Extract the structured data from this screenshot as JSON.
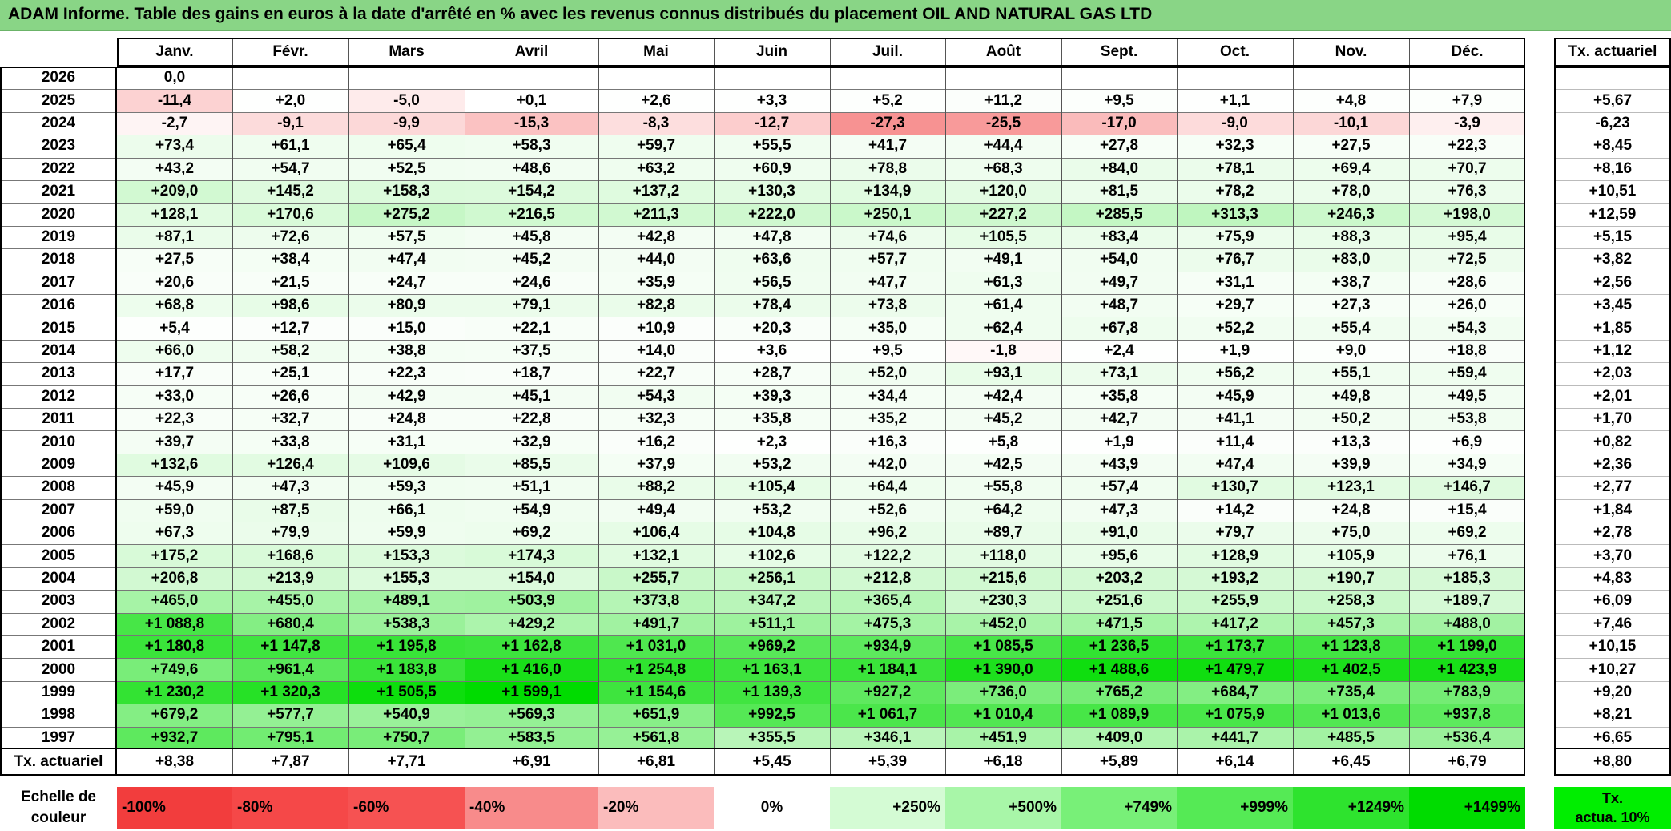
{
  "title": "ADAM Informe. Table des gains en euros à la date d'arrêté en % avec les revenus connus distribués du placement OIL AND NATURAL GAS LTD",
  "months": [
    "Janv.",
    "Févr.",
    "Mars",
    "Avril",
    "Mai",
    "Juin",
    "Juil.",
    "Août",
    "Sept.",
    "Oct.",
    "Nov.",
    "Déc."
  ],
  "rate_header": "Tx. actuariel",
  "rows": [
    {
      "year": "2026",
      "values": [
        "0,0",
        "",
        "",
        "",
        "",
        "",
        "",
        "",
        "",
        "",
        "",
        ""
      ],
      "rate": ""
    },
    {
      "year": "2025",
      "values": [
        "-11,4",
        "+2,0",
        "-5,0",
        "+0,1",
        "+2,6",
        "+3,3",
        "+5,2",
        "+11,2",
        "+9,5",
        "+1,1",
        "+4,8",
        "+7,9"
      ],
      "rate": "+5,67"
    },
    {
      "year": "2024",
      "values": [
        "-2,7",
        "-9,1",
        "-9,9",
        "-15,3",
        "-8,3",
        "-12,7",
        "-27,3",
        "-25,5",
        "-17,0",
        "-9,0",
        "-10,1",
        "-3,9"
      ],
      "rate": "-6,23"
    },
    {
      "year": "2023",
      "values": [
        "+73,4",
        "+61,1",
        "+65,4",
        "+58,3",
        "+59,7",
        "+55,5",
        "+41,7",
        "+44,4",
        "+27,8",
        "+32,3",
        "+27,5",
        "+22,3"
      ],
      "rate": "+8,45"
    },
    {
      "year": "2022",
      "values": [
        "+43,2",
        "+54,7",
        "+52,5",
        "+48,6",
        "+63,2",
        "+60,9",
        "+78,8",
        "+68,3",
        "+84,0",
        "+78,1",
        "+69,4",
        "+70,7"
      ],
      "rate": "+8,16"
    },
    {
      "year": "2021",
      "values": [
        "+209,0",
        "+145,2",
        "+158,3",
        "+154,2",
        "+137,2",
        "+130,3",
        "+134,9",
        "+120,0",
        "+81,5",
        "+78,2",
        "+78,0",
        "+76,3"
      ],
      "rate": "+10,51"
    },
    {
      "year": "2020",
      "values": [
        "+128,1",
        "+170,6",
        "+275,2",
        "+216,5",
        "+211,3",
        "+222,0",
        "+250,1",
        "+227,2",
        "+285,5",
        "+313,3",
        "+246,3",
        "+198,0"
      ],
      "rate": "+12,59"
    },
    {
      "year": "2019",
      "values": [
        "+87,1",
        "+72,6",
        "+57,5",
        "+45,8",
        "+42,8",
        "+47,8",
        "+74,6",
        "+105,5",
        "+83,4",
        "+75,9",
        "+88,3",
        "+95,4"
      ],
      "rate": "+5,15"
    },
    {
      "year": "2018",
      "values": [
        "+27,5",
        "+38,4",
        "+47,4",
        "+45,2",
        "+44,0",
        "+63,6",
        "+57,7",
        "+49,1",
        "+54,0",
        "+76,7",
        "+83,0",
        "+72,5"
      ],
      "rate": "+3,82"
    },
    {
      "year": "2017",
      "values": [
        "+20,6",
        "+21,5",
        "+24,7",
        "+24,6",
        "+35,9",
        "+56,5",
        "+47,7",
        "+61,3",
        "+49,7",
        "+31,1",
        "+38,7",
        "+28,6"
      ],
      "rate": "+2,56"
    },
    {
      "year": "2016",
      "values": [
        "+68,8",
        "+98,6",
        "+80,9",
        "+79,1",
        "+82,8",
        "+78,4",
        "+73,8",
        "+61,4",
        "+48,7",
        "+29,7",
        "+27,3",
        "+26,0"
      ],
      "rate": "+3,45"
    },
    {
      "year": "2015",
      "values": [
        "+5,4",
        "+12,7",
        "+15,0",
        "+22,1",
        "+10,9",
        "+20,3",
        "+35,0",
        "+62,4",
        "+67,8",
        "+52,2",
        "+55,4",
        "+54,3"
      ],
      "rate": "+1,85"
    },
    {
      "year": "2014",
      "values": [
        "+66,0",
        "+58,2",
        "+38,8",
        "+37,5",
        "+14,0",
        "+3,6",
        "+9,5",
        "-1,8",
        "+2,4",
        "+1,9",
        "+9,0",
        "+18,8"
      ],
      "rate": "+1,12"
    },
    {
      "year": "2013",
      "values": [
        "+17,7",
        "+25,1",
        "+22,3",
        "+18,7",
        "+22,7",
        "+28,7",
        "+52,0",
        "+93,1",
        "+73,1",
        "+56,2",
        "+55,1",
        "+59,4"
      ],
      "rate": "+2,03"
    },
    {
      "year": "2012",
      "values": [
        "+33,0",
        "+26,6",
        "+42,9",
        "+45,1",
        "+54,3",
        "+39,3",
        "+34,4",
        "+42,4",
        "+35,8",
        "+45,9",
        "+49,8",
        "+49,5"
      ],
      "rate": "+2,01"
    },
    {
      "year": "2011",
      "values": [
        "+22,3",
        "+32,7",
        "+24,8",
        "+22,8",
        "+32,3",
        "+35,8",
        "+35,2",
        "+45,2",
        "+42,7",
        "+41,1",
        "+50,2",
        "+53,8"
      ],
      "rate": "+1,70"
    },
    {
      "year": "2010",
      "values": [
        "+39,7",
        "+33,8",
        "+31,1",
        "+32,9",
        "+16,2",
        "+2,3",
        "+16,3",
        "+5,8",
        "+1,9",
        "+11,4",
        "+13,3",
        "+6,9"
      ],
      "rate": "+0,82"
    },
    {
      "year": "2009",
      "values": [
        "+132,6",
        "+126,4",
        "+109,6",
        "+85,5",
        "+37,9",
        "+53,2",
        "+42,0",
        "+42,5",
        "+43,9",
        "+47,4",
        "+39,9",
        "+34,9"
      ],
      "rate": "+2,36"
    },
    {
      "year": "2008",
      "values": [
        "+45,9",
        "+47,3",
        "+59,3",
        "+51,1",
        "+88,2",
        "+105,4",
        "+64,4",
        "+55,8",
        "+57,4",
        "+130,7",
        "+123,1",
        "+146,7"
      ],
      "rate": "+2,77"
    },
    {
      "year": "2007",
      "values": [
        "+59,0",
        "+87,5",
        "+66,1",
        "+54,9",
        "+49,4",
        "+53,2",
        "+52,6",
        "+64,2",
        "+47,3",
        "+14,2",
        "+24,8",
        "+15,4"
      ],
      "rate": "+1,84"
    },
    {
      "year": "2006",
      "values": [
        "+67,3",
        "+79,9",
        "+59,9",
        "+69,2",
        "+106,4",
        "+104,8",
        "+96,2",
        "+89,7",
        "+91,0",
        "+79,7",
        "+75,0",
        "+69,2"
      ],
      "rate": "+2,78"
    },
    {
      "year": "2005",
      "values": [
        "+175,2",
        "+168,6",
        "+153,3",
        "+174,3",
        "+132,1",
        "+102,6",
        "+122,2",
        "+118,0",
        "+95,6",
        "+128,9",
        "+105,9",
        "+76,1"
      ],
      "rate": "+3,70"
    },
    {
      "year": "2004",
      "values": [
        "+206,8",
        "+213,9",
        "+155,3",
        "+154,0",
        "+255,7",
        "+256,1",
        "+212,8",
        "+215,6",
        "+203,2",
        "+193,2",
        "+190,7",
        "+185,3"
      ],
      "rate": "+4,83"
    },
    {
      "year": "2003",
      "values": [
        "+465,0",
        "+455,0",
        "+489,1",
        "+503,9",
        "+373,8",
        "+347,2",
        "+365,4",
        "+230,3",
        "+251,6",
        "+255,9",
        "+258,3",
        "+189,7"
      ],
      "rate": "+6,09"
    },
    {
      "year": "2002",
      "values": [
        "+1 088,8",
        "+680,4",
        "+538,3",
        "+429,2",
        "+491,7",
        "+511,1",
        "+475,3",
        "+452,0",
        "+471,5",
        "+417,2",
        "+457,3",
        "+488,0"
      ],
      "rate": "+7,46"
    },
    {
      "year": "2001",
      "values": [
        "+1 180,8",
        "+1 147,8",
        "+1 195,8",
        "+1 162,8",
        "+1 031,0",
        "+969,2",
        "+934,9",
        "+1 085,5",
        "+1 236,5",
        "+1 173,7",
        "+1 123,8",
        "+1 199,0"
      ],
      "rate": "+10,15"
    },
    {
      "year": "2000",
      "values": [
        "+749,6",
        "+961,4",
        "+1 183,8",
        "+1 416,0",
        "+1 254,8",
        "+1 163,1",
        "+1 184,1",
        "+1 390,0",
        "+1 488,6",
        "+1 479,7",
        "+1 402,5",
        "+1 423,9"
      ],
      "rate": "+10,27"
    },
    {
      "year": "1999",
      "values": [
        "+1 230,2",
        "+1 320,3",
        "+1 505,5",
        "+1 599,1",
        "+1 154,6",
        "+1 139,3",
        "+927,2",
        "+736,0",
        "+765,2",
        "+684,7",
        "+735,4",
        "+783,9"
      ],
      "rate": "+9,20"
    },
    {
      "year": "1998",
      "values": [
        "+679,2",
        "+577,7",
        "+540,9",
        "+569,3",
        "+651,9",
        "+992,5",
        "+1 061,7",
        "+1 010,4",
        "+1 089,9",
        "+1 075,9",
        "+1 013,6",
        "+937,8"
      ],
      "rate": "+8,21"
    },
    {
      "year": "1997",
      "values": [
        "+932,7",
        "+795,1",
        "+750,7",
        "+583,5",
        "+561,8",
        "+355,5",
        "+346,1",
        "+451,9",
        "+409,0",
        "+441,7",
        "+485,5",
        "+536,4"
      ],
      "rate": "+6,65"
    }
  ],
  "summary": {
    "label": "Tx. actuariel",
    "values": [
      "+8,38",
      "+7,87",
      "+7,71",
      "+6,91",
      "+6,81",
      "+5,45",
      "+5,39",
      "+6,18",
      "+5,89",
      "+6,14",
      "+6,45",
      "+6,79"
    ],
    "rate": "+8,80"
  },
  "legend": {
    "title_line1": "Echelle de",
    "title_line2": "couleur",
    "items": [
      {
        "label": "-100%",
        "color": "#f23d3d",
        "align": "left"
      },
      {
        "label": "-80%",
        "color": "#f54848",
        "align": "left"
      },
      {
        "label": "-60%",
        "color": "#f65252",
        "align": "left"
      },
      {
        "label": "-40%",
        "color": "#f88b8b",
        "align": "left"
      },
      {
        "label": "-20%",
        "color": "#fbbcbc",
        "align": "left"
      },
      {
        "label": "0%",
        "color": "#ffffff",
        "align": "center"
      },
      {
        "label": "+250%",
        "color": "#d4fbd4",
        "align": "right"
      },
      {
        "label": "+500%",
        "color": "#a8f6a8",
        "align": "right"
      },
      {
        "label": "+749%",
        "color": "#78f078",
        "align": "right"
      },
      {
        "label": "+999%",
        "color": "#55ea55",
        "align": "right"
      },
      {
        "label": "+1249%",
        "color": "#2ee32e",
        "align": "right"
      },
      {
        "label": "+1499%",
        "color": "#00dc00",
        "align": "right"
      }
    ],
    "rate_line1": "Tx.",
    "rate_line2": "actua. 10%"
  }
}
